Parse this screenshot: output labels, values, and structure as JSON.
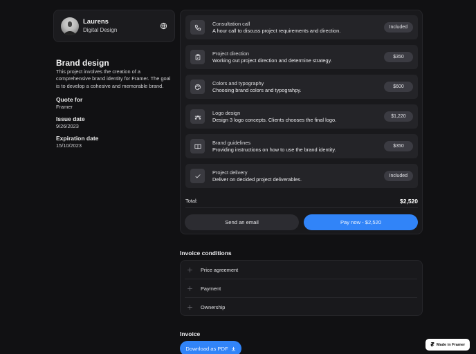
{
  "profile": {
    "name": "Laurens",
    "role": "Digital Design",
    "avatar_icon": "user-avatar",
    "language_icon": "globe-icon"
  },
  "project": {
    "title": "Brand design",
    "description": "This project involves the creation of a comprehensive brand identity for Framer. The goal is to develop a cohesive and memorable brand.",
    "quote_for_label": "Quote for",
    "quote_for_value": "Framer",
    "issue_date_label": "Issue date",
    "issue_date_value": "9/26/2023",
    "expiration_date_label": "Expiration date",
    "expiration_date_value": "15/10/2023"
  },
  "items": [
    {
      "icon": "phone-icon",
      "title": "Consultation call",
      "description": "A hour call to discuss project requirements and direction.",
      "price": "Included"
    },
    {
      "icon": "clipboard-icon",
      "title": "Project direction",
      "description": "Working out project direction and determine strategy.",
      "price": "$350"
    },
    {
      "icon": "palette-icon",
      "title": "Colors and typography",
      "description": "Choosing brand colors and typograhpy.",
      "price": "$600"
    },
    {
      "icon": "bezier-curve-icon",
      "title": "Logo design",
      "description": "Design 3 logo concepts. Clients chooses the final logo.",
      "price": "$1,220"
    },
    {
      "icon": "book-open-icon",
      "title": "Brand guidelines",
      "description": "Providing instructions on how to use the brand identity.",
      "price": "$350"
    },
    {
      "icon": "check-icon",
      "title": "Project delivery",
      "description": "Deliver on decided project deliverables.",
      "price": "Included"
    }
  ],
  "total": {
    "label": "Total:",
    "value": "$2,520"
  },
  "actions": {
    "send_email": "Send an email",
    "pay_now": "Pay now - $2,520"
  },
  "conditions": {
    "title": "Invoice conditions",
    "items": [
      {
        "label": "Price agreement"
      },
      {
        "label": "Payment"
      },
      {
        "label": "Ownership"
      }
    ]
  },
  "invoice": {
    "title": "Invoice",
    "download_label": "Download as PDF"
  },
  "badge": {
    "label": "Made in Framer"
  },
  "colors": {
    "background": "#111113",
    "card": "#19191c",
    "item": "#242428",
    "accent": "#3184f8"
  }
}
